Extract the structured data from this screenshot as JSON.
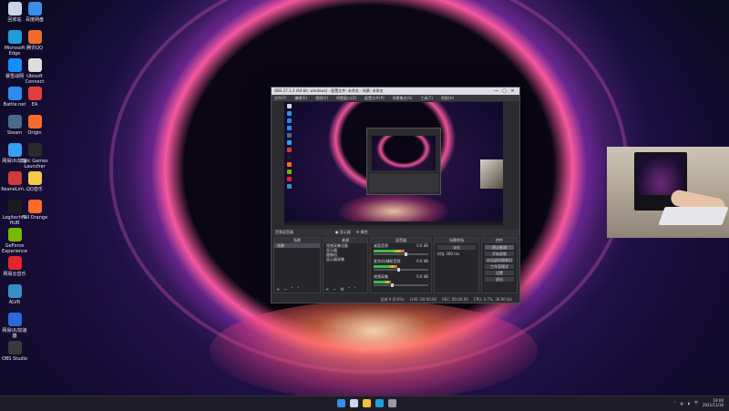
{
  "desktop": {
    "icons": [
      {
        "label": "回收站",
        "color": "#c9d6e8"
      },
      {
        "label": "百度网盘",
        "color": "#3a8ee6"
      },
      {
        "label": "Microsoft Edge",
        "color": "#1f9ed8"
      },
      {
        "label": "腾讯QQ",
        "color": "#f26b2b"
      },
      {
        "label": "暴雪战网",
        "color": "#148eff"
      },
      {
        "label": "Ubisoft Connect",
        "color": "#dddddd"
      },
      {
        "label": "Battle.net",
        "color": "#2b8cf0"
      },
      {
        "label": "EA",
        "color": "#e2403b"
      },
      {
        "label": "Steam",
        "color": "#4a6a8a"
      },
      {
        "label": "Origin",
        "color": "#f56c2d"
      },
      {
        "label": "网易UU加速",
        "color": "#34a1f2"
      },
      {
        "label": "Epic Games Launcher",
        "color": "#2a2a2a"
      },
      {
        "label": "KeaneLim...",
        "color": "#d03c3c"
      },
      {
        "label": "QQ音乐",
        "color": "#f7c948"
      },
      {
        "label": "Logitech G HUB",
        "color": "#1c1c1c"
      },
      {
        "label": "Fall Orange",
        "color": "#ff6a2b"
      },
      {
        "label": "GeForce Experience",
        "color": "#76b900"
      },
      {
        "label": "网易云音乐",
        "color": "#e2262b"
      },
      {
        "label": "ALVR",
        "color": "#3a8ec8"
      },
      {
        "label": "网易UU加速器",
        "color": "#2a6ad8"
      },
      {
        "label": "OBS Studio",
        "color": "#3a3a3a"
      }
    ]
  },
  "obs": {
    "title": "OBS 27.1.3 (64-bit, windows) - 配置文件: 未命名 - 场景: 未命名",
    "win_buttons": [
      "—",
      "▢",
      "✕"
    ],
    "menus": [
      "文件(F)",
      "编辑(E)",
      "视图(V)",
      "停靠窗口(D)",
      "配置文件(P)",
      "场景集合(S)",
      "工具(T)",
      "帮助(H)"
    ],
    "mixer_labels": [
      "音频混音器",
      "● 显示器",
      "⚙ 属性"
    ],
    "docks": {
      "scenes": {
        "title": "场景",
        "items": [
          "场景"
        ]
      },
      "sources": {
        "title": "来源",
        "items": [
          "视频采集设备",
          "显示器",
          "摄像机",
          "显示器采集"
        ]
      },
      "audio": {
        "title": "混音器",
        "tracks": [
          {
            "name": "桌面音频",
            "db": "0.0 dB",
            "level": 0.62
          },
          {
            "name": "麦克风/辅助音频",
            "db": "0.0 dB",
            "level": 0.48
          },
          {
            "name": "视频采集",
            "db": "0.0 dB",
            "level": 0.35
          }
        ]
      },
      "transitions": {
        "title": "场景转场",
        "type": "淡化",
        "duration_label": "时长",
        "duration": "300 ms"
      },
      "controls": {
        "title": "控件",
        "buttons": [
          "停止推流",
          "开始录制",
          "启动虚拟摄像机",
          "工作室模式",
          "设置",
          "退出"
        ],
        "active": "停止推流"
      }
    },
    "status": [
      "丢帧 0 (0.0%)",
      "LIVE: 00:00:00",
      "REC: 00:00:00",
      "CPU: 4.7%, 30.00 fps"
    ]
  },
  "taskbar": {
    "apps": [
      {
        "name": "start-icon",
        "color": "#3a8ee6"
      },
      {
        "name": "search-icon",
        "color": "#cfd6e4"
      },
      {
        "name": "file-explorer-icon",
        "color": "#f4c13a"
      },
      {
        "name": "edge-icon",
        "color": "#1f9ed8"
      },
      {
        "name": "obs-icon",
        "color": "#9a9aa2"
      }
    ],
    "clock_time": "19:00",
    "clock_date": "2021/11/16"
  }
}
